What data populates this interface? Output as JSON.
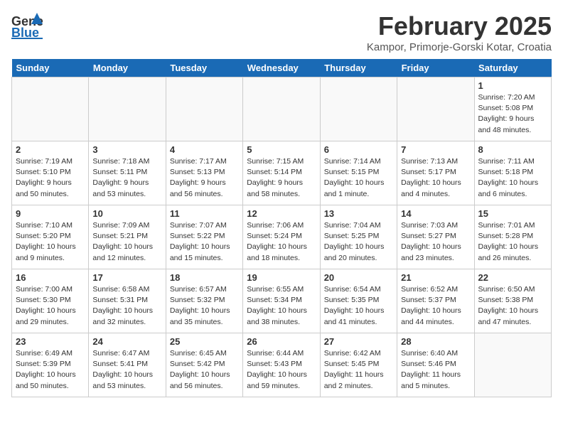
{
  "header": {
    "logo_general": "General",
    "logo_blue": "Blue",
    "month_title": "February 2025",
    "location": "Kampor, Primorje-Gorski Kotar, Croatia"
  },
  "weekdays": [
    "Sunday",
    "Monday",
    "Tuesday",
    "Wednesday",
    "Thursday",
    "Friday",
    "Saturday"
  ],
  "weeks": [
    [
      {
        "day": "",
        "info": ""
      },
      {
        "day": "",
        "info": ""
      },
      {
        "day": "",
        "info": ""
      },
      {
        "day": "",
        "info": ""
      },
      {
        "day": "",
        "info": ""
      },
      {
        "day": "",
        "info": ""
      },
      {
        "day": "1",
        "info": "Sunrise: 7:20 AM\nSunset: 5:08 PM\nDaylight: 9 hours and 48 minutes."
      }
    ],
    [
      {
        "day": "2",
        "info": "Sunrise: 7:19 AM\nSunset: 5:10 PM\nDaylight: 9 hours and 50 minutes."
      },
      {
        "day": "3",
        "info": "Sunrise: 7:18 AM\nSunset: 5:11 PM\nDaylight: 9 hours and 53 minutes."
      },
      {
        "day": "4",
        "info": "Sunrise: 7:17 AM\nSunset: 5:13 PM\nDaylight: 9 hours and 56 minutes."
      },
      {
        "day": "5",
        "info": "Sunrise: 7:15 AM\nSunset: 5:14 PM\nDaylight: 9 hours and 58 minutes."
      },
      {
        "day": "6",
        "info": "Sunrise: 7:14 AM\nSunset: 5:15 PM\nDaylight: 10 hours and 1 minute."
      },
      {
        "day": "7",
        "info": "Sunrise: 7:13 AM\nSunset: 5:17 PM\nDaylight: 10 hours and 4 minutes."
      },
      {
        "day": "8",
        "info": "Sunrise: 7:11 AM\nSunset: 5:18 PM\nDaylight: 10 hours and 6 minutes."
      }
    ],
    [
      {
        "day": "9",
        "info": "Sunrise: 7:10 AM\nSunset: 5:20 PM\nDaylight: 10 hours and 9 minutes."
      },
      {
        "day": "10",
        "info": "Sunrise: 7:09 AM\nSunset: 5:21 PM\nDaylight: 10 hours and 12 minutes."
      },
      {
        "day": "11",
        "info": "Sunrise: 7:07 AM\nSunset: 5:22 PM\nDaylight: 10 hours and 15 minutes."
      },
      {
        "day": "12",
        "info": "Sunrise: 7:06 AM\nSunset: 5:24 PM\nDaylight: 10 hours and 18 minutes."
      },
      {
        "day": "13",
        "info": "Sunrise: 7:04 AM\nSunset: 5:25 PM\nDaylight: 10 hours and 20 minutes."
      },
      {
        "day": "14",
        "info": "Sunrise: 7:03 AM\nSunset: 5:27 PM\nDaylight: 10 hours and 23 minutes."
      },
      {
        "day": "15",
        "info": "Sunrise: 7:01 AM\nSunset: 5:28 PM\nDaylight: 10 hours and 26 minutes."
      }
    ],
    [
      {
        "day": "16",
        "info": "Sunrise: 7:00 AM\nSunset: 5:30 PM\nDaylight: 10 hours and 29 minutes."
      },
      {
        "day": "17",
        "info": "Sunrise: 6:58 AM\nSunset: 5:31 PM\nDaylight: 10 hours and 32 minutes."
      },
      {
        "day": "18",
        "info": "Sunrise: 6:57 AM\nSunset: 5:32 PM\nDaylight: 10 hours and 35 minutes."
      },
      {
        "day": "19",
        "info": "Sunrise: 6:55 AM\nSunset: 5:34 PM\nDaylight: 10 hours and 38 minutes."
      },
      {
        "day": "20",
        "info": "Sunrise: 6:54 AM\nSunset: 5:35 PM\nDaylight: 10 hours and 41 minutes."
      },
      {
        "day": "21",
        "info": "Sunrise: 6:52 AM\nSunset: 5:37 PM\nDaylight: 10 hours and 44 minutes."
      },
      {
        "day": "22",
        "info": "Sunrise: 6:50 AM\nSunset: 5:38 PM\nDaylight: 10 hours and 47 minutes."
      }
    ],
    [
      {
        "day": "23",
        "info": "Sunrise: 6:49 AM\nSunset: 5:39 PM\nDaylight: 10 hours and 50 minutes."
      },
      {
        "day": "24",
        "info": "Sunrise: 6:47 AM\nSunset: 5:41 PM\nDaylight: 10 hours and 53 minutes."
      },
      {
        "day": "25",
        "info": "Sunrise: 6:45 AM\nSunset: 5:42 PM\nDaylight: 10 hours and 56 minutes."
      },
      {
        "day": "26",
        "info": "Sunrise: 6:44 AM\nSunset: 5:43 PM\nDaylight: 10 hours and 59 minutes."
      },
      {
        "day": "27",
        "info": "Sunrise: 6:42 AM\nSunset: 5:45 PM\nDaylight: 11 hours and 2 minutes."
      },
      {
        "day": "28",
        "info": "Sunrise: 6:40 AM\nSunset: 5:46 PM\nDaylight: 11 hours and 5 minutes."
      },
      {
        "day": "",
        "info": ""
      }
    ]
  ]
}
